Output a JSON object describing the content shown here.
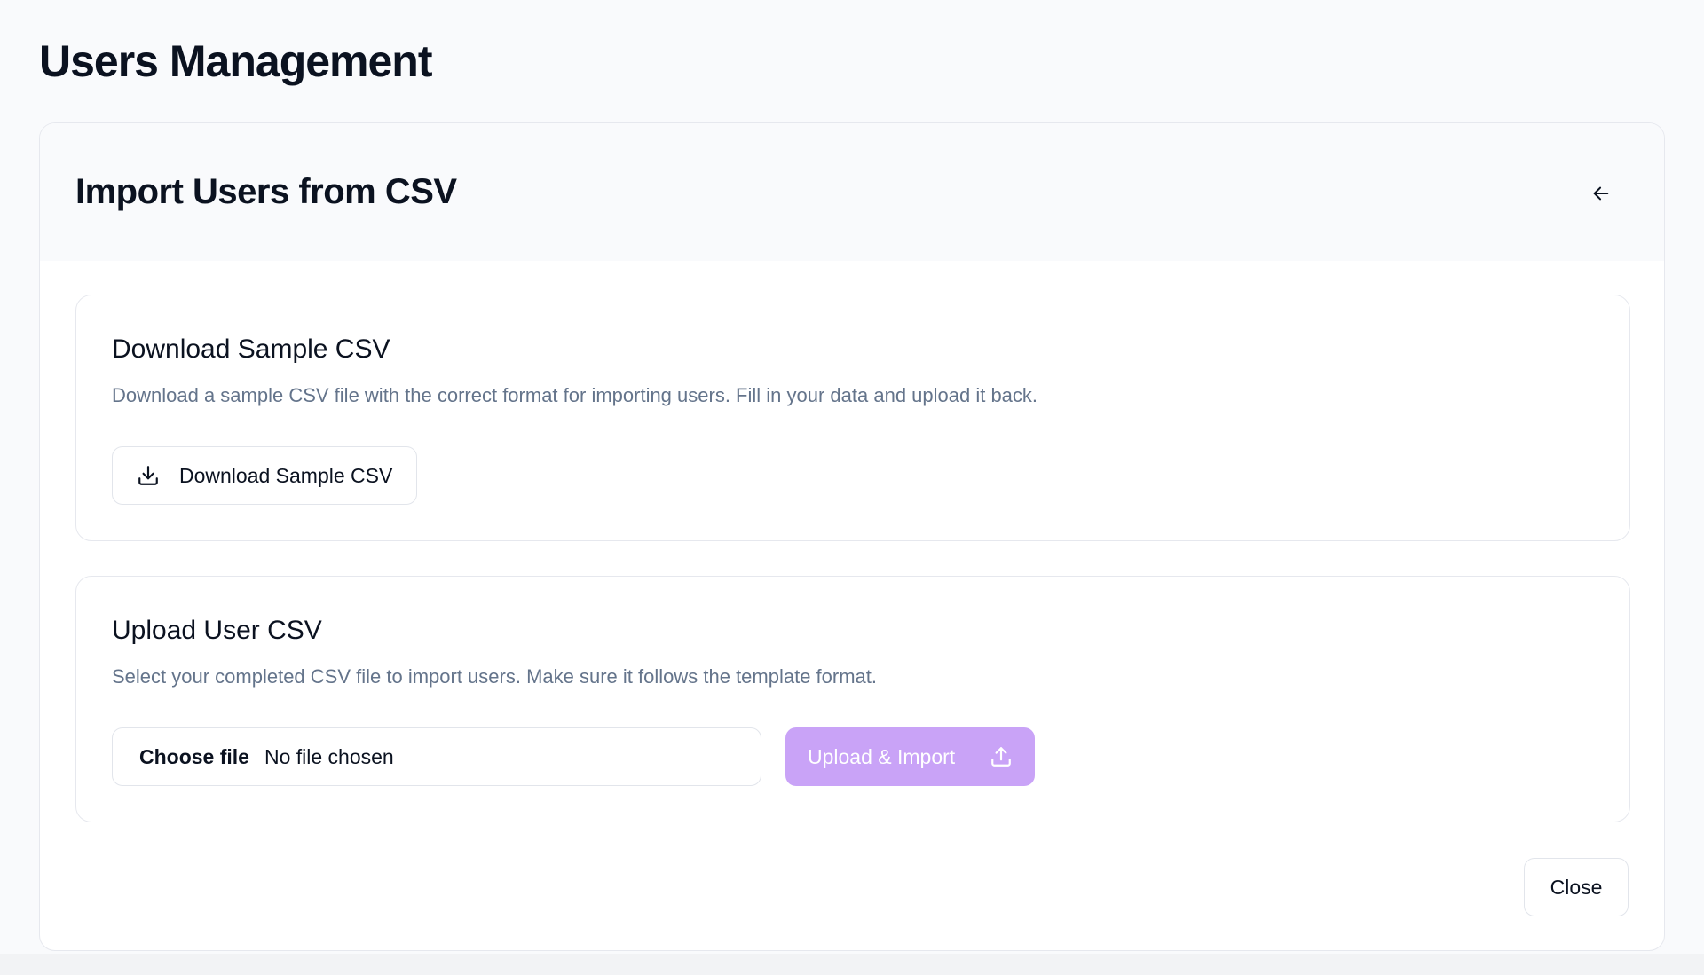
{
  "page": {
    "title": "Users Management"
  },
  "dialog": {
    "title": "Import Users from CSV",
    "back_icon": "arrow-left-icon"
  },
  "download_section": {
    "title": "Download Sample CSV",
    "description": "Download a sample CSV file with the correct format for importing users. Fill in your data and upload it back.",
    "button_label": "Download Sample CSV",
    "button_icon": "download-icon"
  },
  "upload_section": {
    "title": "Upload User CSV",
    "description": "Select your completed CSV file to import users. Make sure it follows the template format.",
    "file_input": {
      "button_label": "Choose file",
      "status": "No file chosen"
    },
    "upload_button_label": "Upload & Import",
    "upload_button_icon": "upload-icon",
    "upload_button_color": "#c9a3f7"
  },
  "footer": {
    "close_label": "Close"
  }
}
